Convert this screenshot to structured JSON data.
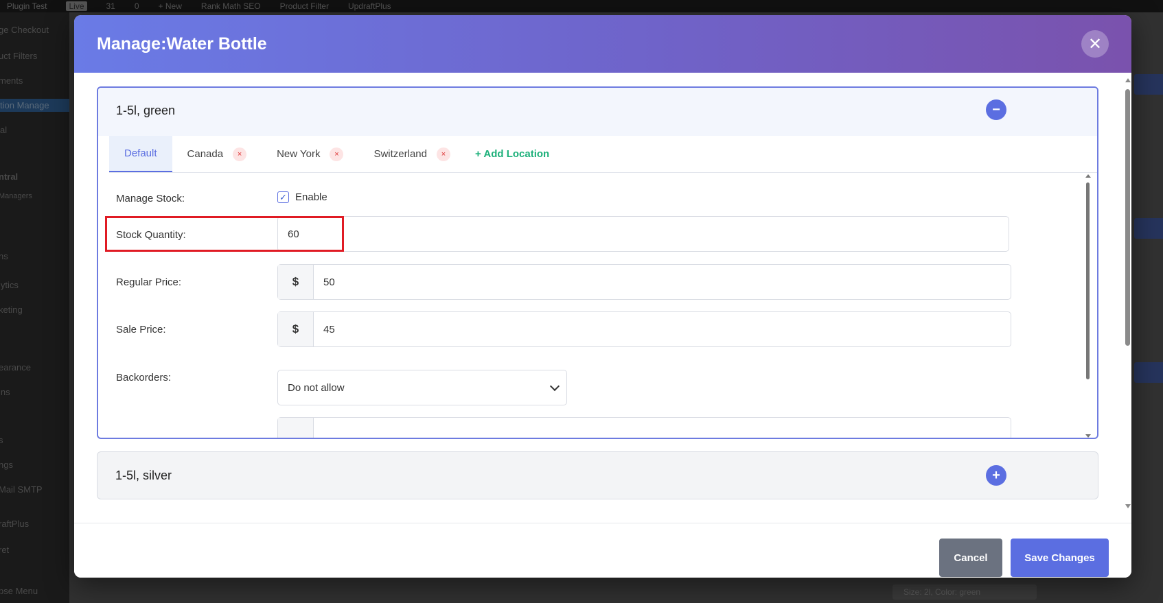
{
  "background": {
    "adminbar": [
      "Plugin Test",
      "Live",
      "31",
      "0",
      "+ New",
      "Rank Math SEO",
      "Product Filter",
      "UpdraftPlus"
    ],
    "sidebar": [
      "ge Checkout",
      "uct Filters",
      "ments",
      "tion Manage",
      "al",
      "ntral",
      "Managers",
      "ns",
      "lytics",
      "keting",
      "earance",
      "ins",
      "s",
      "ngs",
      "Mail SMTP",
      "raftPlus",
      "ret",
      "pse Menu"
    ],
    "bottom_label": "Size: 2l, Color: green"
  },
  "modal": {
    "title": "Manage:Water Bottle",
    "close_symbol": "✕",
    "variations": [
      {
        "title": "1-5l, green",
        "expanded": true,
        "toggle_symbol": "−",
        "tabs": [
          {
            "label": "Default",
            "active": true,
            "removable": false
          },
          {
            "label": "Canada",
            "active": false,
            "removable": true
          },
          {
            "label": "New York",
            "active": false,
            "removable": true
          },
          {
            "label": "Switzerland",
            "active": false,
            "removable": true
          }
        ],
        "remove_symbol": "×",
        "add_location": "+ Add Location",
        "fields": {
          "manage_stock_label": "Manage Stock:",
          "manage_stock_checked": true,
          "manage_stock_option": "Enable",
          "stock_quantity_label": "Stock Quantity:",
          "stock_quantity_value": "60",
          "regular_price_label": "Regular Price:",
          "regular_price_currency": "$",
          "regular_price_value": "50",
          "sale_price_label": "Sale Price:",
          "sale_price_currency": "$",
          "sale_price_value": "45",
          "backorders_label": "Backorders:",
          "backorders_value": "Do not allow"
        }
      },
      {
        "title": "1-5l, silver",
        "expanded": false,
        "toggle_symbol": "+"
      }
    ],
    "footer": {
      "cancel_label": "Cancel",
      "save_label": "Save Changes"
    }
  },
  "colors": {
    "accent": "#5b6ee1",
    "add_location": "#1db07a",
    "highlight": "#e01b24",
    "cancel_button": "#6b7280"
  }
}
